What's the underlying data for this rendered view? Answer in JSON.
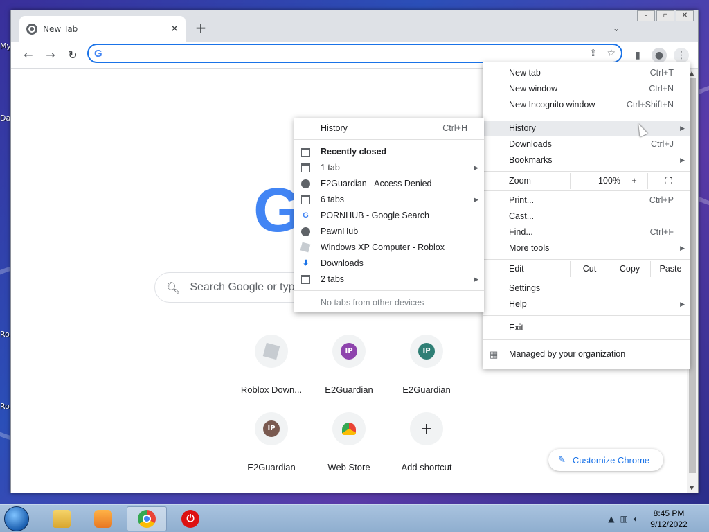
{
  "desktop": {
    "labels": [
      "My",
      "Da",
      "Ro",
      "Ro"
    ]
  },
  "browser": {
    "tab": {
      "title": "New Tab",
      "close": "✕"
    },
    "new_tab_symbol": "+",
    "tab_search_symbol": "⌄",
    "window_controls": [
      "–",
      "▫",
      "✕"
    ],
    "omnibox": {
      "value": "",
      "placeholder": ""
    }
  },
  "newtab": {
    "search_placeholder": "Search Google or typ",
    "shortcuts": [
      {
        "label": "Roblox Down...",
        "icon": "roblox-icon"
      },
      {
        "label": "E2Guardian",
        "icon": "ip-icon",
        "initials": "IP",
        "color": "#8e44ad"
      },
      {
        "label": "E2Guardian",
        "icon": "ip-icon",
        "initials": "IP",
        "color": "#2f7f75"
      },
      {
        "label": "E2Guardian",
        "icon": "ip-icon",
        "initials": "IP",
        "color": "#7a5a50"
      },
      {
        "label": "Web Store",
        "icon": "webstore-icon"
      },
      {
        "label": "Add shortcut",
        "icon": "plus-icon",
        "symbol": "+"
      }
    ],
    "customize_label": "Customize Chrome"
  },
  "main_menu": {
    "items": [
      {
        "label": "New tab",
        "shortcut": "Ctrl+T"
      },
      {
        "label": "New window",
        "shortcut": "Ctrl+N"
      },
      {
        "label": "New Incognito window",
        "shortcut": "Ctrl+Shift+N"
      },
      {
        "label": "History",
        "shortcut": ""
      },
      {
        "label": "Downloads",
        "shortcut": "Ctrl+J"
      },
      {
        "label": "Bookmarks",
        "shortcut": ""
      },
      {
        "label": "Zoom",
        "shortcut": ""
      },
      {
        "label": "Print...",
        "shortcut": "Ctrl+P"
      },
      {
        "label": "Cast...",
        "shortcut": ""
      },
      {
        "label": "Find...",
        "shortcut": "Ctrl+F"
      },
      {
        "label": "More tools",
        "shortcut": ""
      },
      {
        "label": "Edit",
        "shortcut": ""
      },
      {
        "label": "Settings",
        "shortcut": ""
      },
      {
        "label": "Help",
        "shortcut": ""
      },
      {
        "label": "Exit",
        "shortcut": ""
      },
      {
        "label": "Managed by your organization",
        "shortcut": ""
      }
    ],
    "zoom": {
      "minus": "–",
      "value": "100%",
      "plus": "+"
    },
    "edit": {
      "cut": "Cut",
      "copy": "Copy",
      "paste": "Paste"
    }
  },
  "history_menu": {
    "history": {
      "label": "History",
      "shortcut": "Ctrl+H"
    },
    "recently_closed": "Recently closed",
    "items": [
      {
        "label": "1 tab",
        "icon": "window-icon"
      },
      {
        "label": "E2Guardian - Access Denied",
        "icon": "globe-icon"
      },
      {
        "label": "6 tabs",
        "icon": "window-icon"
      },
      {
        "label": "PORNHUB - Google Search",
        "icon": "google-icon"
      },
      {
        "label": "PawnHub",
        "icon": "globe-icon"
      },
      {
        "label": "Windows XP Computer - Roblox",
        "icon": "roblox-icon"
      },
      {
        "label": "Downloads",
        "icon": "download-icon"
      },
      {
        "label": "2 tabs",
        "icon": "window-icon"
      }
    ],
    "footer": "No tabs from other devices"
  },
  "taskbar": {
    "clock": {
      "time": "8:45 PM",
      "date": "9/12/2022"
    }
  }
}
